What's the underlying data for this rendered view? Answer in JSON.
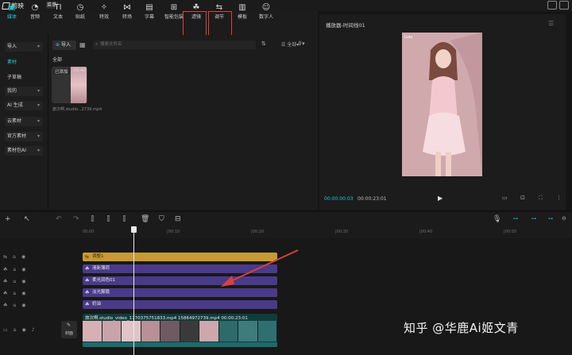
{
  "app": {
    "title": "剪映",
    "menu_label": "菜单"
  },
  "toolbar": {
    "tools": [
      {
        "label": "媒体",
        "icon": "media-icon"
      },
      {
        "label": "音频",
        "icon": "audio-icon"
      },
      {
        "label": "文本",
        "icon": "text-icon"
      },
      {
        "label": "贴纸",
        "icon": "sticker-icon"
      },
      {
        "label": "特效",
        "icon": "effects-icon"
      },
      {
        "label": "转场",
        "icon": "transition-icon"
      },
      {
        "label": "字幕",
        "icon": "subtitle-icon"
      },
      {
        "label": "智能包装",
        "icon": "smart-pack-icon"
      },
      {
        "label": "滤镜",
        "icon": "filter-icon"
      },
      {
        "label": "调节",
        "icon": "adjust-icon"
      },
      {
        "label": "模板",
        "icon": "template-icon"
      },
      {
        "label": "数字人",
        "icon": "digital-human-icon"
      }
    ],
    "active": "媒体"
  },
  "left_nav": {
    "items": [
      {
        "label": "导入",
        "style": "box"
      },
      {
        "label": "素材",
        "style": "plain",
        "active": true
      },
      {
        "label": "子草稿",
        "style": "plain"
      },
      {
        "label": "我的",
        "style": "box"
      },
      {
        "label": "AI 生成",
        "style": "box"
      },
      {
        "label": "云素材",
        "style": "box"
      },
      {
        "label": "官方素材",
        "style": "box"
      },
      {
        "label": "素材包AI",
        "style": "box"
      }
    ]
  },
  "media": {
    "import_label": "导入",
    "search_placeholder": "搜索文件名",
    "section_label": "全部",
    "clip": {
      "badge": "已添加",
      "duration": "00:42",
      "filename": "旅次啊.studio...2739.mp4"
    }
  },
  "player": {
    "title": "播放器-时间线01",
    "watermark_text": "Lulu",
    "current_time": "00:00:00:03",
    "total_time": "00:00:23:01"
  },
  "timeline": {
    "ruler": [
      "00:00",
      "|00:10",
      "|00:20",
      "|00:30",
      "|00:40",
      "|00:50"
    ],
    "tracks": [
      {
        "label": "调整1",
        "color": "gold"
      },
      {
        "label": "清新薄荷",
        "color": "purple"
      },
      {
        "label": "柔光润色01",
        "color": "purple"
      },
      {
        "label": "淡光朦胧",
        "color": "purple"
      },
      {
        "label": "奶油",
        "color": "purple"
      }
    ],
    "main_clip_label": "旅次啊.studio_video_1770375751833.mp4 15864972739.mp4  00:00:23:01",
    "cover_label": "封面"
  },
  "colors": {
    "accent": "#24c6cf",
    "gold_track": "#c79a35",
    "purple_track": "#4a3a8a",
    "annotation": "#d94040"
  },
  "overlay": {
    "watermark": "知乎 @华鹿Ai姬文青"
  }
}
